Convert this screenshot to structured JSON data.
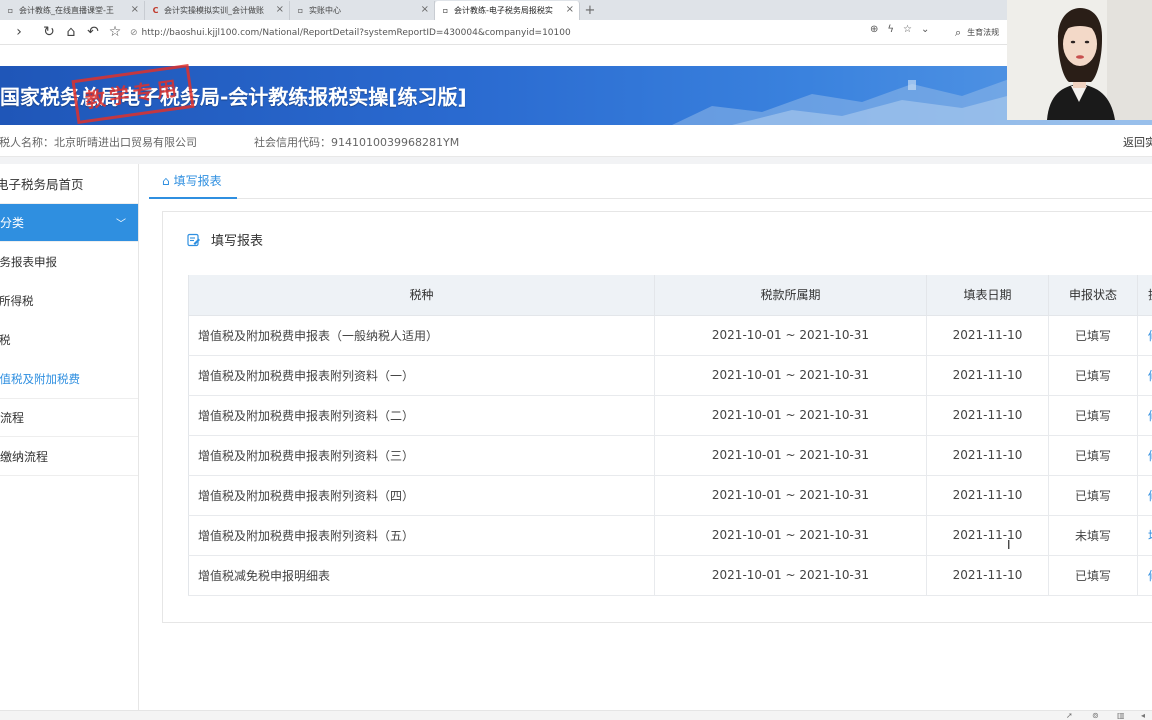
{
  "browser": {
    "tabs": [
      {
        "title": "会计教练_在线直播课堂-王",
        "active": false
      },
      {
        "title": "会计实操模拟实训_会计做账",
        "active": false
      },
      {
        "title": "实账中心",
        "active": false
      },
      {
        "title": "会计教练-电子税务局报税实",
        "active": true
      }
    ],
    "new_tab": "+",
    "url": "http://baoshui.kjjl100.com/National/ReportDetail?systemReportID=430004&companyid=10100",
    "search_text": "生育法规"
  },
  "banner": {
    "title": "国家税务总局电子税务局-会计教练报税实操[练习版]",
    "stamp": "教学专用"
  },
  "info": {
    "taxpayer_name": "纳税人名称：北京昕晴进出口贸易有限公司",
    "credit_code": "社会信用代码：9141010039968281YM",
    "return_link": "返回实"
  },
  "sidebar": {
    "items": [
      {
        "label": "电子税务局首页",
        "kind": "home"
      },
      {
        "label": "申报分类",
        "kind": "group"
      },
      {
        "label": "财务报表申报",
        "kind": "sub"
      },
      {
        "label": "个人所得税",
        "kind": "sub"
      },
      {
        "label": "印花税",
        "kind": "sub"
      },
      {
        "label": "增值税及附加税费",
        "kind": "sub-active"
      },
      {
        "label": "申报流程",
        "kind": "plain"
      },
      {
        "label": "税款缴纳流程",
        "kind": "plain"
      }
    ]
  },
  "main": {
    "tab_label": "填写报表",
    "panel_title": "填写报表",
    "table": {
      "headers": [
        "税种",
        "税款所属期",
        "填表日期",
        "申报状态",
        "操作"
      ],
      "rows": [
        {
          "name": "增值税及附加税费申报表（一般纳税人适用）",
          "period": "2021-10-01 ~ 2021-10-31",
          "date": "2021-11-10",
          "status": "已填写",
          "action": "修改"
        },
        {
          "name": "增值税及附加税费申报表附列资料（一）",
          "period": "2021-10-01 ~ 2021-10-31",
          "date": "2021-11-10",
          "status": "已填写",
          "action": "修改"
        },
        {
          "name": "增值税及附加税费申报表附列资料（二）",
          "period": "2021-10-01 ~ 2021-10-31",
          "date": "2021-11-10",
          "status": "已填写",
          "action": "修改"
        },
        {
          "name": "增值税及附加税费申报表附列资料（三）",
          "period": "2021-10-01 ~ 2021-10-31",
          "date": "2021-11-10",
          "status": "已填写",
          "action": "修改"
        },
        {
          "name": "增值税及附加税费申报表附列资料（四）",
          "period": "2021-10-01 ~ 2021-10-31",
          "date": "2021-11-10",
          "status": "已填写",
          "action": "修改"
        },
        {
          "name": "增值税及附加税费申报表附列资料（五）",
          "period": "2021-10-01 ~ 2021-10-31",
          "date": "2021-11-10",
          "status": "未填写",
          "action": "填写"
        },
        {
          "name": "增值税减免税申报明细表",
          "period": "2021-10-01 ~ 2021-10-31",
          "date": "2021-11-10",
          "status": "已填写",
          "action": "修改"
        }
      ]
    }
  },
  "colors": {
    "accent": "#2f8fe0",
    "banner": "#2a6ad0",
    "stamp": "#e0312b",
    "header_bg": "#eef2f6"
  }
}
